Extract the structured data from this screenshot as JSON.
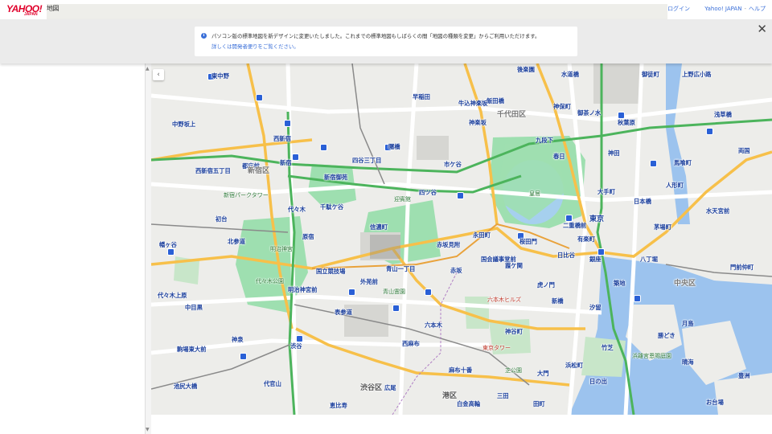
{
  "header": {
    "logo_text": "YAHOO!",
    "logo_sub": "JAPAN",
    "service_name": "地図",
    "login": "ログイン",
    "site": "Yahoo! JAPAN",
    "separator": "-",
    "help": "ヘルプ"
  },
  "notice": {
    "text": "パソコン版の標準地図を新デザインに変更いたしました。これまでの標準地図もしばらくの間「地図の種類を変更」からご利用いただけます。",
    "link": "詳しくは開発者便りをご覧ください。"
  },
  "map_labels": {
    "higashinakano": "東中野",
    "nakanosakaue": "中野坂上",
    "nishishinjuku": "西新宿",
    "shinjuku": "新宿",
    "tochomae": "都庁前",
    "nishishinjuku5": "西新宿五丁目",
    "shinjuku_park_tower": "新宿パークタワー",
    "hatsudai": "初台",
    "hatagaya": "幡ヶ谷",
    "sasazuka": "笹塚",
    "yoyogi": "代々木",
    "meijijingu": "明治神宮",
    "yoyogi_park": "代々木公園",
    "harajuku": "原宿",
    "meijijingumae": "明治神宮前",
    "omotesando": "表参道",
    "shibuya": "渋谷",
    "shibuya_ku": "渋谷区",
    "ebisu": "恵比寿",
    "hiroo": "広尾",
    "roppongi": "六本木",
    "roppongi_hills": "六本木ヒルズ",
    "akasaka": "赤坂",
    "akasakamitsuke": "赤坂見附",
    "aoyama1": "青山一丁目",
    "gaienmae": "外苑前",
    "shinanomachi": "信濃町",
    "yotsuya": "四ツ谷",
    "ichigaya": "市ケ谷",
    "iidabashi": "飯田橋",
    "kudanshita": "九段下",
    "jimbocho": "神保町",
    "ochanomizu": "御茶ノ水",
    "akihabara": "秋葉原",
    "kanda": "神田",
    "tokyo": "東京",
    "otemachi": "大手町",
    "nijubashimae": "二重橋前",
    "hibiya": "日比谷",
    "ginza": "銀座",
    "yurakucho": "有楽町",
    "shimbashi": "新橋",
    "toranomon": "虎ノ門",
    "kasumigaseki": "霞ケ関",
    "nagatacho": "永田町",
    "kokkai": "国会議事堂前",
    "sakuradamon": "桜田門",
    "kokyo": "皇居",
    "kamiyacho": "神谷町",
    "shiba_park": "芝公園",
    "hamamatsucho": "浜松町",
    "daimon": "大門",
    "azabujuban": "麻布十番",
    "tokyo_tower": "東京タワー",
    "nihombashi": "日本橋",
    "kayabacho": "茅場町",
    "hatchobori": "八丁堀",
    "tsukiji": "築地",
    "tsukishima": "月島",
    "kachidoki": "勝どき",
    "minato_ku": "港区",
    "shinjuku_ku": "新宿区",
    "chiyoda_ku": "千代田区",
    "chuo_ku": "中央区",
    "waseda": "早稲田",
    "kagurazaka": "神楽坂",
    "ushigome": "牛込神楽坂",
    "akebonobashi": "曙橋",
    "yoyogi_uehara": "代々木上原",
    "komaba": "駒場東大前",
    "ikejiri": "池尻大橋",
    "shinsen": "神泉",
    "daikanyama": "代官山",
    "nakameguro": "中目黒",
    "suidobashi": "水道橋",
    "kasuga": "春日",
    "korakuen": "後楽園",
    "ueno_hirokoji": "上野広小路",
    "okachimachi": "御徒町",
    "asakusabashi": "浅草橋",
    "ryogoku": "両国",
    "bakurocho": "馬喰町",
    "ningyocho": "人形町",
    "suitengumae": "水天宮前",
    "monzen": "門前仲町",
    "toyosu": "豊洲",
    "odaiba": "お台場",
    "shiodome": "汐留",
    "takeshiba": "竹芝",
    "hinode": "日の出",
    "tamachi": "田町",
    "mita": "三田",
    "shirokane": "白金高輪",
    "kitasando": "北参道",
    "sendagaya": "千駄ケ谷",
    "kokuritsu": "国立競技場",
    "yotsuya3": "四谷三丁目",
    "akasaka_palace": "迎賓館",
    "aoyama_cemetery": "青山霊園",
    "shinjuku_gyoen": "新宿御苑",
    "hamarikyu": "浜離宮恩賜庭園",
    "nishiazabu": "西麻布",
    "harumi": "晴海"
  }
}
